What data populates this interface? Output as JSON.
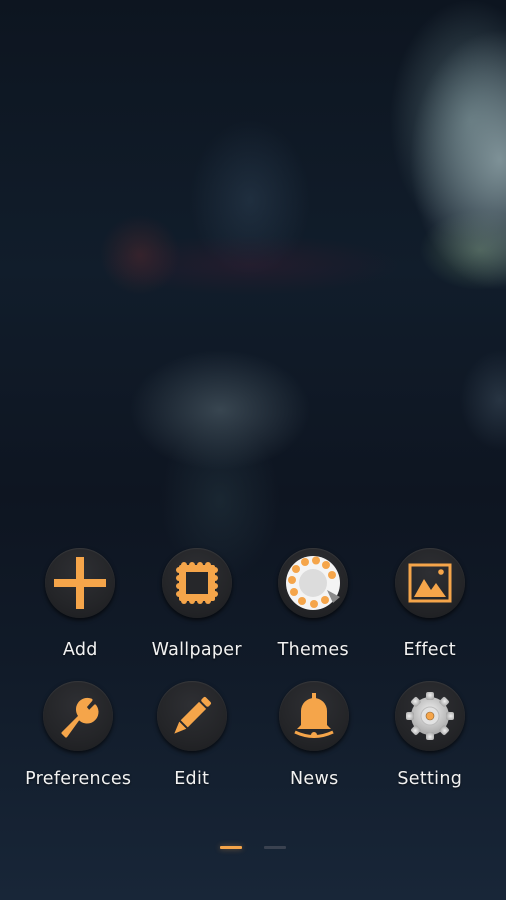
{
  "screen": "Launcher menu",
  "accent_color": "#f5a54a",
  "menu": {
    "items": [
      {
        "label": "Add",
        "icon": "plus-icon"
      },
      {
        "label": "Wallpaper",
        "icon": "stamp-frame-icon"
      },
      {
        "label": "Themes",
        "icon": "rotary-dial-icon"
      },
      {
        "label": "Effect",
        "icon": "picture-icon"
      },
      {
        "label": "Preferences",
        "icon": "wrench-icon"
      },
      {
        "label": "Edit",
        "icon": "pencil-icon"
      },
      {
        "label": "News",
        "icon": "bell-icon"
      },
      {
        "label": "Setting",
        "icon": "gear-icon"
      }
    ]
  },
  "pager": {
    "pages": 2,
    "current_page": 1
  }
}
